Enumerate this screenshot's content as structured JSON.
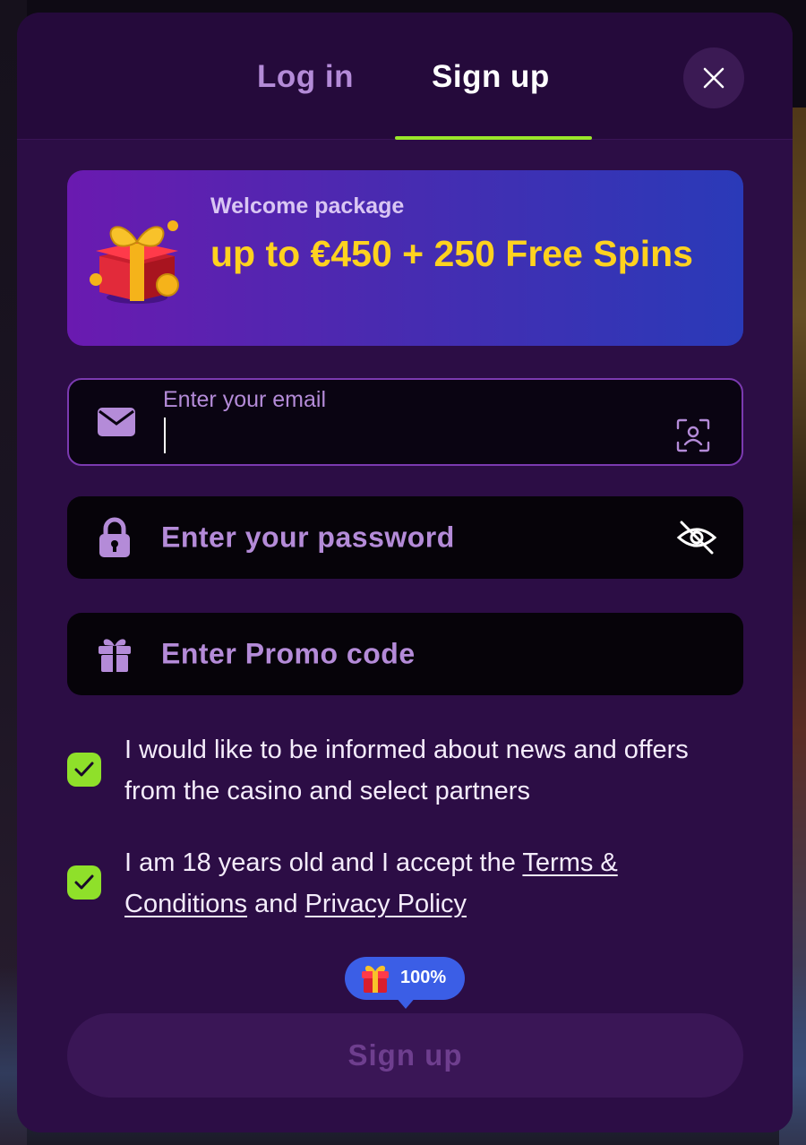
{
  "tabs": [
    {
      "label": "Log in",
      "active": false
    },
    {
      "label": "Sign up",
      "active": true
    }
  ],
  "colors": {
    "accent": "#9ae62a",
    "banner_text": "#ffd21f",
    "modal_bg": "#2c0d45",
    "field_label": "#b48bd8"
  },
  "banner": {
    "subtitle": "Welcome package",
    "title": "up to €450 + 250 Free Spins",
    "icon": "gift-box-icon"
  },
  "form": {
    "email": {
      "label": "Enter your email",
      "value": "",
      "icon": "envelope-icon",
      "action_icon": "face-scan-icon"
    },
    "password": {
      "placeholder": "Enter your password",
      "icon": "lock-icon",
      "action_icon": "eye-slash-icon"
    },
    "promo": {
      "placeholder": "Enter Promo code",
      "icon": "gift-icon"
    }
  },
  "consents": [
    {
      "checked": true,
      "text": "I would like to be informed about news and offers from the casino and select partners"
    },
    {
      "checked": true,
      "text_before": "I am 18 years old and I accept the ",
      "terms_link": "Terms & Conditions",
      "text_middle": " and ",
      "privacy_link": "Privacy Policy"
    }
  ],
  "bonus_badge": {
    "text": "100%",
    "icon": "gift-icon"
  },
  "submit": {
    "label": "Sign up",
    "enabled": false
  }
}
